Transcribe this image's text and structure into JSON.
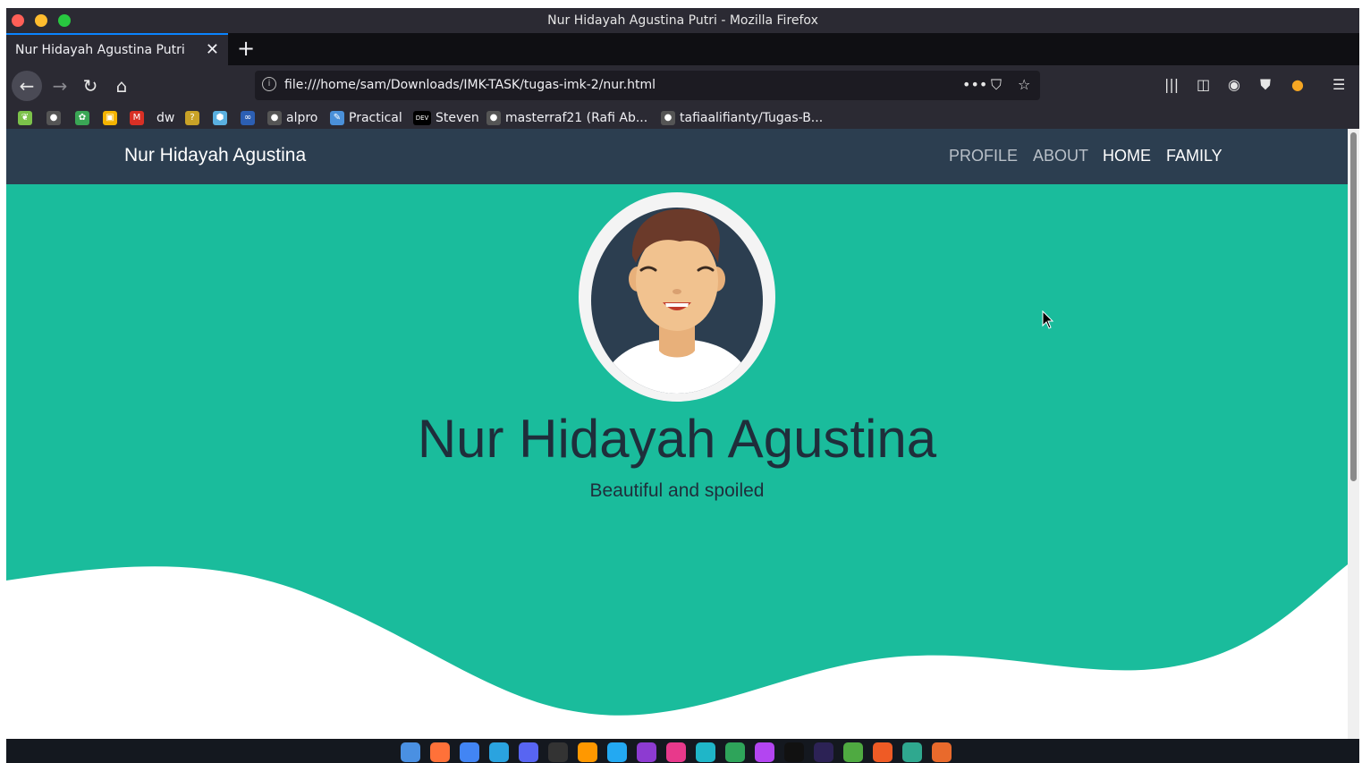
{
  "window": {
    "title": "Nur Hidayah Agustina Putri - Mozilla Firefox"
  },
  "tab": {
    "title": "Nur Hidayah Agustina Putri",
    "close": "✕",
    "new_tab": "+"
  },
  "toolbar": {
    "back": "←",
    "forward": "→",
    "reload": "↻",
    "home": "⌂",
    "url": "file:///home/sam/Downloads/IMK-TASK/tugas-imk-2/nur.html",
    "page_actions": "•••",
    "menu": "☰"
  },
  "bookmarks": [
    {
      "label": "",
      "icon": "leaf-icon",
      "color": "#7cc24a"
    },
    {
      "label": "",
      "icon": "github-icon",
      "color": "#555"
    },
    {
      "label": "",
      "icon": "school-icon",
      "color": "#3aa655"
    },
    {
      "label": "",
      "icon": "classroom-icon",
      "color": "#f5b400"
    },
    {
      "label": "",
      "icon": "gmail-icon",
      "color": "#d93025"
    },
    {
      "label": "dw",
      "icon": "dw-icon",
      "color": "transparent"
    },
    {
      "label": "",
      "icon": "question-icon",
      "color": "#c9a227"
    },
    {
      "label": "",
      "icon": "hexagon-icon",
      "color": "#5ab0e0"
    },
    {
      "label": "",
      "icon": "infinity-icon",
      "color": "#2c5fb3"
    },
    {
      "label": "alpro",
      "icon": "github-icon",
      "color": "#555"
    },
    {
      "label": "Practical",
      "icon": "feather-icon",
      "color": "#4a90d9"
    },
    {
      "label": "Steven",
      "icon": "dev-icon",
      "color": "#000"
    },
    {
      "label": "masterraf21 (Rafi Ab...",
      "icon": "github-icon",
      "color": "#555"
    },
    {
      "label": "tafiaalifianty/Tugas-B...",
      "icon": "github-icon",
      "color": "#555"
    }
  ],
  "site": {
    "brand": "Nur Hidayah Agustina",
    "menu": [
      "PROFILE",
      "ABOUT",
      "HOME",
      "FAMILY"
    ],
    "hero_name": "Nur Hidayah Agustina",
    "hero_subtitle": "Beautiful and spoiled",
    "colors": {
      "nav": "#2c3e50",
      "hero": "#1abc9c",
      "text": "#1f2e3b"
    }
  },
  "dock_icons": [
    "finder-icon",
    "firefox-icon",
    "chrome-icon",
    "telegram-icon",
    "discord-icon",
    "terminal-icon",
    "sublime-icon",
    "vscode-icon",
    "goland-icon",
    "intellij-icon",
    "webstorm-icon",
    "datagrip-icon",
    "phpstorm-icon",
    "jetbrains-icon",
    "eclipse-icon",
    "mongodb-icon",
    "postman-icon",
    "files-icon",
    "trash-icon"
  ]
}
